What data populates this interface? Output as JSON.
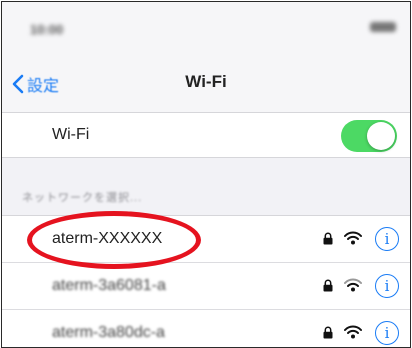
{
  "status_bar": {
    "time": "10:00"
  },
  "nav": {
    "back_label": "設定",
    "title": "Wi-Fi"
  },
  "wifi_toggle": {
    "label": "Wi-Fi",
    "on": true,
    "color": "#4cd964"
  },
  "section": {
    "header": "ネットワークを選択..."
  },
  "networks": [
    {
      "name": "aterm-XXXXXX",
      "secured": true,
      "highlighted": true
    },
    {
      "name": "aterm-3a6081-a",
      "secured": true
    },
    {
      "name": "aterm-3a80dc-a",
      "secured": true
    }
  ],
  "accent_color": "#1a7cf5",
  "highlight_color": "#e5131f",
  "icons": {
    "back": "chevron-left-icon",
    "lock": "lock-icon",
    "wifi": "wifi-icon",
    "info": "info-icon"
  }
}
